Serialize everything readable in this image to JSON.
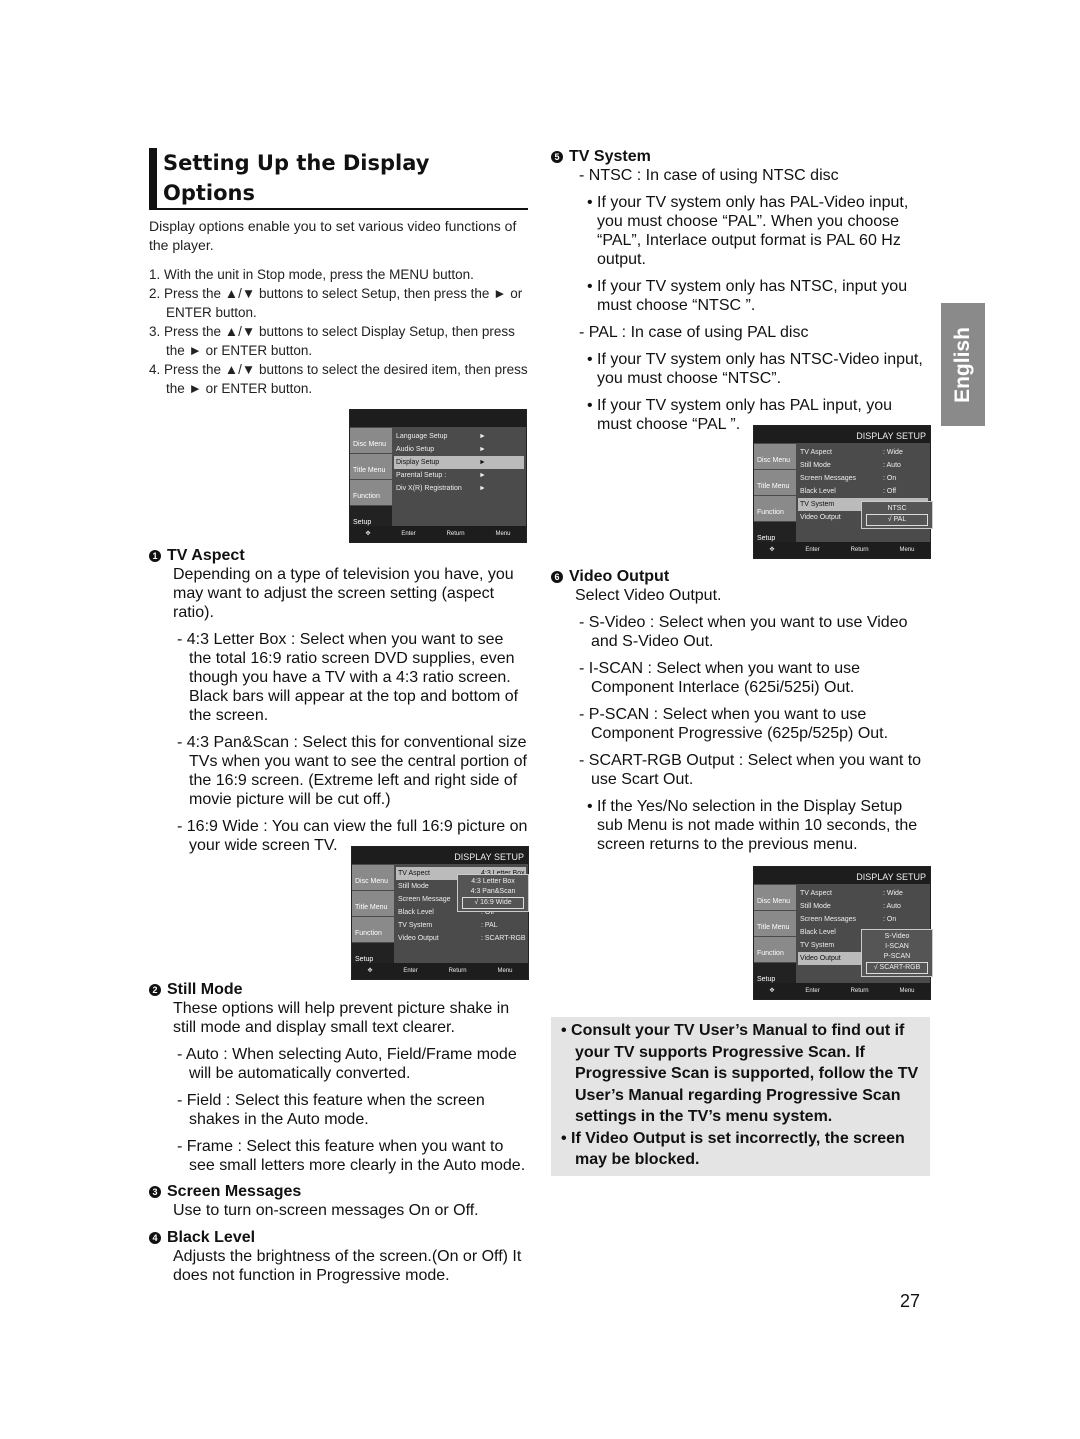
{
  "title": "Setting Up the Display Options",
  "intro": "Display options enable you to set various video functions of the player.",
  "steps": [
    "1. With the unit in Stop mode, press the MENU button.",
    "2. Press the ▲/▼ buttons to select Setup, then press the ► or ENTER button.",
    "3. Press the ▲/▼ buttons to select Display Setup, then press the ► or ENTER button.",
    "4. Press the ▲/▼ buttons to select the desired item, then press the ► or ENTER button."
  ],
  "side_tab": "English",
  "page_number": "27",
  "osd": [
    {
      "header": "",
      "side": [
        "Disc Menu",
        "Title Menu",
        "Function",
        "Setup"
      ],
      "rows": [
        {
          "l": "Language Setup",
          "v": "►"
        },
        {
          "l": "Audio Setup",
          "v": "►"
        },
        {
          "l": "Display Setup",
          "v": "►",
          "hl": true
        },
        {
          "l": "Parental Setup :",
          "v": "►"
        },
        {
          "l": "Div X(R) Registration",
          "v": "►"
        }
      ],
      "popup": null,
      "footer": [
        "Enter",
        "Return",
        "Menu"
      ]
    },
    {
      "header": "DISPLAY SETUP",
      "side": [
        "Disc Menu",
        "Title Menu",
        "Function",
        "Setup"
      ],
      "rows": [
        {
          "l": "TV Aspect",
          "v": "4:3 Letter Box",
          "hl": true
        },
        {
          "l": "Still Mode",
          "v": ""
        },
        {
          "l": "Screen Message",
          "v": ""
        },
        {
          "l": "Black Level",
          "v": ": Off"
        },
        {
          "l": "TV System",
          "v": ": PAL"
        },
        {
          "l": "Video Output",
          "v": ": SCART-RGB"
        }
      ],
      "popup": {
        "options": [
          "4:3 Letter Box",
          "4:3 Pan&Scan",
          "√ 16:9 Wide"
        ],
        "checked": 2
      },
      "footer": [
        "Enter",
        "Return",
        "Menu"
      ]
    },
    {
      "header": "DISPLAY SETUP",
      "side": [
        "Disc Menu",
        "Title Menu",
        "Function",
        "Setup"
      ],
      "rows": [
        {
          "l": "TV Aspect",
          "v": ": Wide"
        },
        {
          "l": "Still Mode",
          "v": ": Auto"
        },
        {
          "l": "Screen Messages",
          "v": ": On"
        },
        {
          "l": "Black Level",
          "v": ": Off"
        },
        {
          "l": "TV System",
          "v": "",
          "hl": true
        },
        {
          "l": "Video Output",
          "v": ""
        }
      ],
      "popup": {
        "options": [
          "NTSC",
          "√ PAL"
        ],
        "checked": 1
      },
      "footer": [
        "Enter",
        "Return",
        "Menu"
      ]
    },
    {
      "header": "DISPLAY SETUP",
      "side": [
        "Disc Menu",
        "Title Menu",
        "Function",
        "Setup"
      ],
      "rows": [
        {
          "l": "TV Aspect",
          "v": ": Wide"
        },
        {
          "l": "Still Mode",
          "v": ": Auto"
        },
        {
          "l": "Screen Messages",
          "v": ": On"
        },
        {
          "l": "Black Level",
          "v": ""
        },
        {
          "l": "TV System",
          "v": ""
        },
        {
          "l": "Video Output",
          "v": "",
          "hl": true
        }
      ],
      "popup": {
        "options": [
          "S-Video",
          "I-SCAN",
          "P-SCAN",
          "√ SCART-RGB"
        ],
        "checked": 3
      },
      "footer": [
        "Enter",
        "Return",
        "Menu"
      ]
    }
  ],
  "s1": {
    "num": "1",
    "title": "TV Aspect",
    "desc": "Depending on a type of television you have, you may want to adjust the screen setting (aspect ratio).",
    "items": [
      "- 4:3 Letter Box : Select when you want to see the total 16:9 ratio screen DVD supplies, even though you have a TV with a 4:3 ratio screen. Black bars will appear at the top and bottom of the screen.",
      "- 4:3 Pan&Scan : Select this for conventional size TVs when you want to see the central portion of the 16:9 screen. (Extreme left and right side of movie picture will be cut off.)",
      "- 16:9 Wide : You can view the full 16:9 picture on your wide screen TV."
    ]
  },
  "s2": {
    "num": "2",
    "title": "Still Mode",
    "desc": "These options will help prevent picture shake in still mode and display small text clearer.",
    "items": [
      "- Auto : When selecting Auto, Field/Frame mode will be automatically converted.",
      "- Field : Select this feature when the screen shakes in the Auto mode.",
      "- Frame : Select this feature when you want to see small letters more clearly in the Auto mode."
    ]
  },
  "s3": {
    "num": "3",
    "title": "Screen Messages",
    "desc": "Use to turn on-screen messages On or Off."
  },
  "s4": {
    "num": "4",
    "title": "Black Level",
    "desc": "Adjusts the brightness of the screen.(On or Off) It does not function in Progressive mode."
  },
  "s5": {
    "num": "5",
    "title": "TV System",
    "lines": [
      [
        "item",
        "- NTSC : In case of using NTSC disc"
      ],
      [
        "bul",
        "• If your TV system only has PAL-Video input, you must choose “PAL”. When you choose “PAL”, Interlace output format is PAL 60 Hz output."
      ],
      [
        "bul",
        "• If your TV system only has NTSC, input you must choose “NTSC ”."
      ],
      [
        "item",
        "- PAL : In case of using PAL disc"
      ],
      [
        "bul",
        "• If your TV system only has NTSC-Video input, you must choose “NTSC”."
      ],
      [
        "bul",
        "• If your TV system only has PAL input, you must choose “PAL ”."
      ]
    ]
  },
  "s6": {
    "num": "6",
    "title": "Video Output",
    "desc": "Select Video Output.",
    "lines": [
      [
        "item",
        "- S-Video : Select when you want to use Video and S-Video Out."
      ],
      [
        "item",
        "- I-SCAN : Select when you want to use Component Interlace (625i/525i) Out."
      ],
      [
        "item",
        "- P-SCAN : Select when you want to use Component Progressive (625p/525p) Out."
      ],
      [
        "item",
        "- SCART-RGB Output : Select when you want to use Scart Out."
      ],
      [
        "bul",
        "• If the Yes/No selection in the Display Setup sub Menu is not made within 10 seconds, the screen returns to the previous menu."
      ]
    ]
  },
  "note": [
    "• Consult your TV User’s Manual to find out if your TV supports Progressive Scan. If Progressive Scan is supported, follow the TV User’s Manual regarding Progressive Scan settings in the TV’s menu system.",
    "• If Video Output is set incorrectly, the screen may be blocked."
  ]
}
